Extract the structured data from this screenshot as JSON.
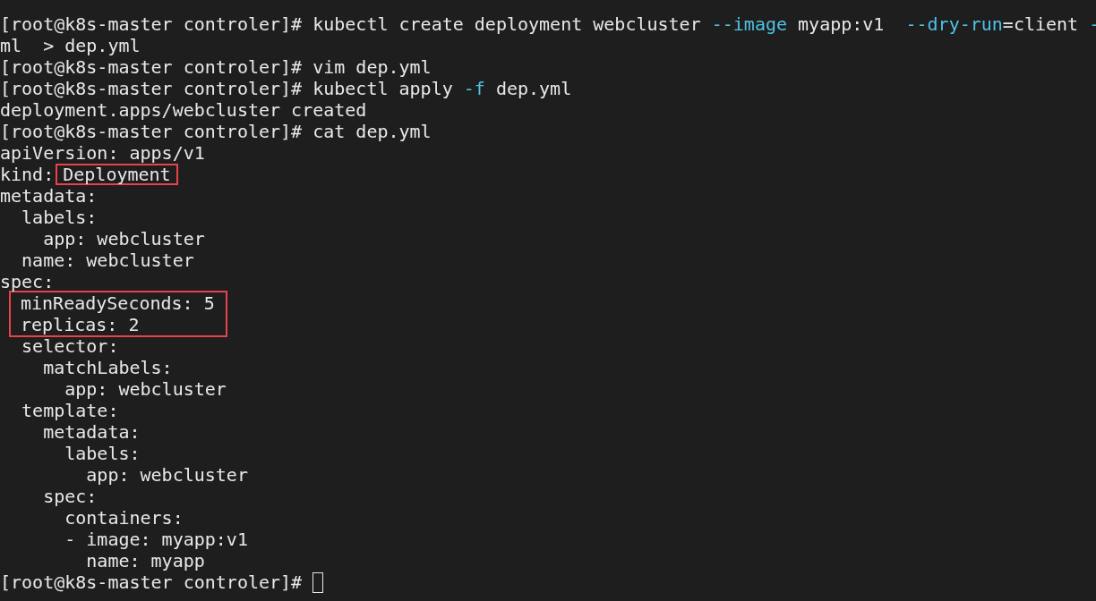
{
  "terminal": {
    "lines": [
      {
        "kind": "line",
        "segments": [
          {
            "text": "[root@k8s-master controler]# kubectl create deployment webcluster ",
            "kind": "plain"
          },
          {
            "text": "--image",
            "kind": "option"
          },
          {
            "text": " myapp:v1  ",
            "kind": "plain"
          },
          {
            "text": "--dry-run",
            "kind": "option"
          },
          {
            "text": "=client ",
            "kind": "plain"
          },
          {
            "text": "-",
            "kind": "option"
          }
        ]
      },
      {
        "kind": "line",
        "segments": [
          {
            "text": "ml  > dep.yml",
            "kind": "plain"
          }
        ]
      },
      {
        "kind": "line",
        "segments": [
          {
            "text": "[root@k8s-master controler]# vim dep.yml",
            "kind": "plain"
          }
        ]
      },
      {
        "kind": "line",
        "segments": [
          {
            "text": "[root@k8s-master controler]# kubectl apply ",
            "kind": "plain"
          },
          {
            "text": "-f",
            "kind": "option"
          },
          {
            "text": " dep.yml",
            "kind": "plain"
          }
        ]
      },
      {
        "kind": "line",
        "segments": [
          {
            "text": "deployment.apps/webcluster created",
            "kind": "plain"
          }
        ]
      },
      {
        "kind": "line",
        "segments": [
          {
            "text": "[root@k8s-master controler]# cat dep.yml",
            "kind": "plain"
          }
        ]
      },
      {
        "kind": "line",
        "segments": [
          {
            "text": "apiVersion: apps/v1",
            "kind": "plain"
          }
        ]
      },
      {
        "kind": "line",
        "segments": [
          {
            "text": "kind:",
            "kind": "plain"
          },
          {
            "text": "Deployment",
            "kind": "boxed"
          }
        ]
      },
      {
        "kind": "line",
        "segments": [
          {
            "text": "metadata:",
            "kind": "plain"
          }
        ]
      },
      {
        "kind": "line",
        "segments": [
          {
            "text": "  labels:",
            "kind": "plain"
          }
        ]
      },
      {
        "kind": "line",
        "segments": [
          {
            "text": "    app: webcluster",
            "kind": "plain"
          }
        ]
      },
      {
        "kind": "line",
        "segments": [
          {
            "text": "  name: webcluster",
            "kind": "plain"
          }
        ]
      },
      {
        "kind": "line",
        "segments": [
          {
            "text": "spec:",
            "kind": "plain"
          }
        ]
      },
      {
        "kind": "boxed_group",
        "lines": [
          "minReadySeconds: 5",
          "replicas: 2"
        ]
      },
      {
        "kind": "line",
        "segments": [
          {
            "text": "  selector:",
            "kind": "plain"
          }
        ]
      },
      {
        "kind": "line",
        "segments": [
          {
            "text": "    matchLabels:",
            "kind": "plain"
          }
        ]
      },
      {
        "kind": "line",
        "segments": [
          {
            "text": "      app: webcluster",
            "kind": "plain"
          }
        ]
      },
      {
        "kind": "line",
        "segments": [
          {
            "text": "  template:",
            "kind": "plain"
          }
        ]
      },
      {
        "kind": "line",
        "segments": [
          {
            "text": "    metadata:",
            "kind": "plain"
          }
        ]
      },
      {
        "kind": "line",
        "segments": [
          {
            "text": "      labels:",
            "kind": "plain"
          }
        ]
      },
      {
        "kind": "line",
        "segments": [
          {
            "text": "        app: webcluster",
            "kind": "plain"
          }
        ]
      },
      {
        "kind": "line",
        "segments": [
          {
            "text": "    spec:",
            "kind": "plain"
          }
        ]
      },
      {
        "kind": "line",
        "segments": [
          {
            "text": "      containers:",
            "kind": "plain"
          }
        ]
      },
      {
        "kind": "line",
        "segments": [
          {
            "text": "      - image: myapp:v1",
            "kind": "plain"
          }
        ]
      },
      {
        "kind": "line",
        "segments": [
          {
            "text": "        name: myapp",
            "kind": "plain"
          }
        ]
      },
      {
        "kind": "line",
        "cursor": true,
        "segments": [
          {
            "text": "[root@k8s-master controler]# ",
            "kind": "plain"
          }
        ]
      }
    ]
  }
}
